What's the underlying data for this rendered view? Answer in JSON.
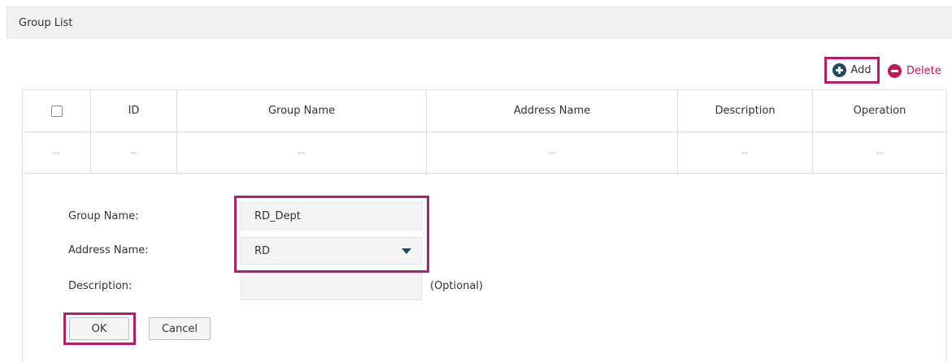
{
  "panel": {
    "title": "Group List"
  },
  "toolbar": {
    "add_label": "Add",
    "add_icon": "plus-circle-icon",
    "delete_label": "Delete",
    "delete_icon": "minus-circle-icon"
  },
  "table": {
    "columns": [
      "ID",
      "Group Name",
      "Address Name",
      "Description",
      "Operation"
    ],
    "rows": [
      {
        "checkbox": "--",
        "id": "--",
        "group_name": "--",
        "address_name": "--",
        "description": "--",
        "operation": "--"
      }
    ]
  },
  "form": {
    "group_name_label": "Group Name:",
    "group_name_value": "RD_Dept",
    "address_name_label": "Address Name:",
    "address_name_value": "RD",
    "description_label": "Description:",
    "description_value": "",
    "description_hint": "(Optional)",
    "ok_label": "OK",
    "cancel_label": "Cancel"
  },
  "colors": {
    "highlight": "#b11e6b",
    "accent": "#1f4b57",
    "delete": "#c2185b"
  }
}
